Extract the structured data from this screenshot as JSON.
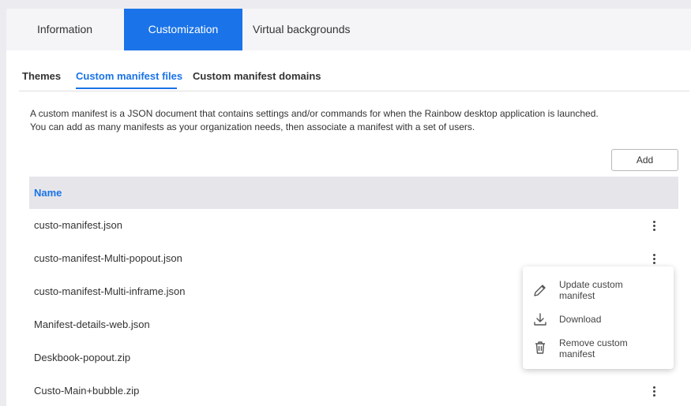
{
  "top_tabs": [
    {
      "label": "Information"
    },
    {
      "label": "Customization"
    },
    {
      "label": "Virtual backgrounds"
    }
  ],
  "sub_tabs": [
    {
      "label": "Themes"
    },
    {
      "label": "Custom manifest files"
    },
    {
      "label": "Custom manifest domains"
    }
  ],
  "description": {
    "line1": "A custom manifest is a JSON document that contains settings and/or commands for when the Rainbow desktop application is launched.",
    "line2": "You can add as many manifests as your organization needs, then associate a manifest with a set of users."
  },
  "add_button": "Add",
  "table": {
    "header_name": "Name",
    "rows": [
      {
        "name": "custo-manifest.json"
      },
      {
        "name": "custo-manifest-Multi-popout.json"
      },
      {
        "name": "custo-manifest-Multi-inframe.json"
      },
      {
        "name": "Manifest-details-web.json"
      },
      {
        "name": "Deskbook-popout.zip"
      },
      {
        "name": "Custo-Main+bubble.zip"
      }
    ]
  },
  "context_menu": {
    "items": [
      {
        "label": "Update custom manifest",
        "icon": "pencil-icon"
      },
      {
        "label": "Download",
        "icon": "download-icon"
      },
      {
        "label": "Remove custom manifest",
        "icon": "trash-icon"
      }
    ]
  },
  "colors": {
    "accent": "#1a73e8",
    "header_bg": "#e6e6ea"
  }
}
